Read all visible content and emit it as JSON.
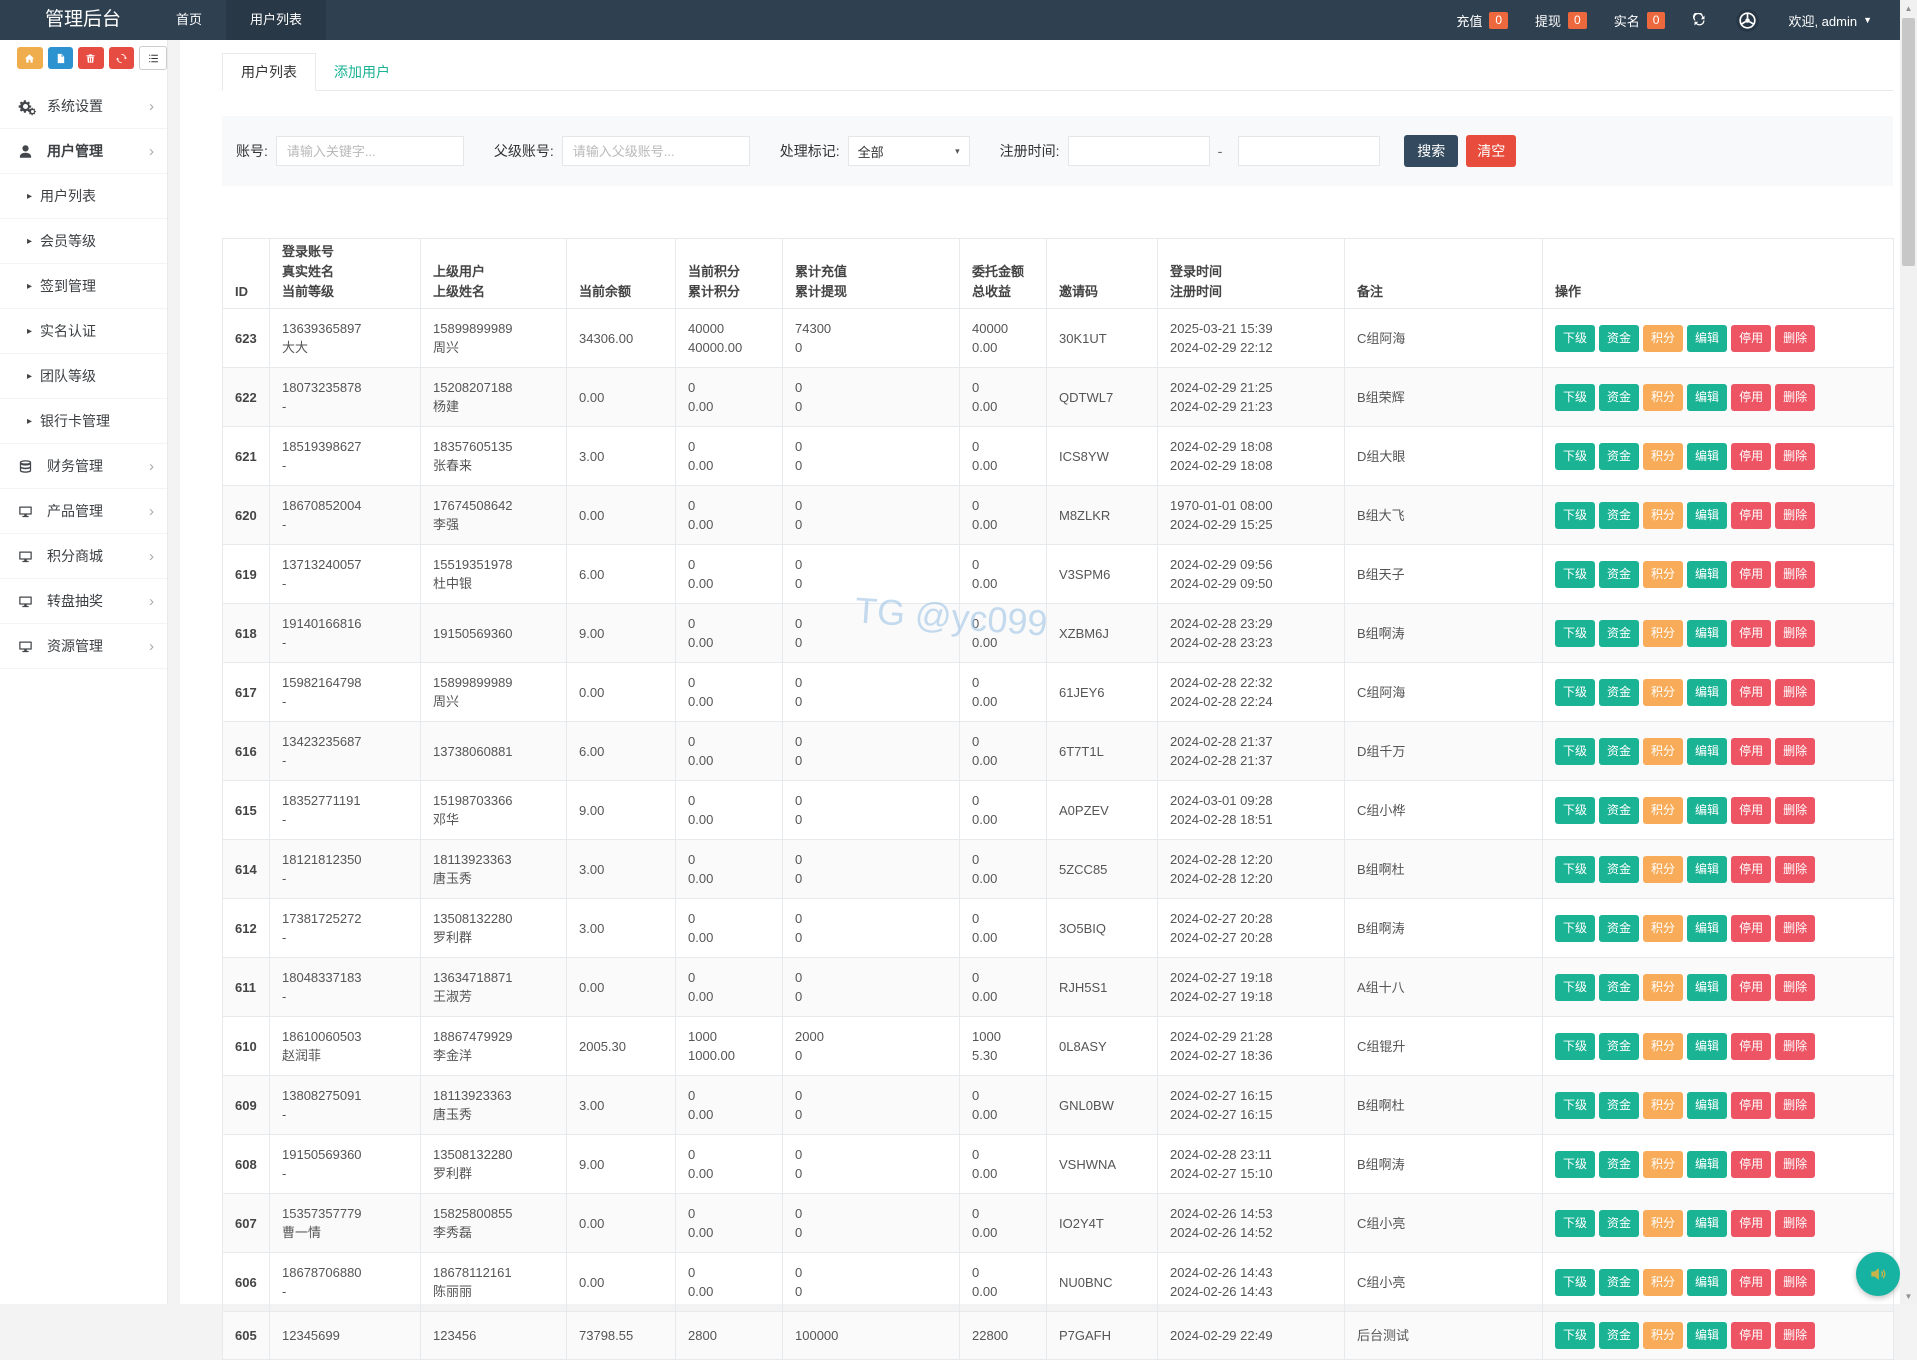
{
  "colors": {
    "navbar": "#2f4050",
    "navbar_active_tab": "#293846",
    "teal": "#1ab394",
    "orange": "#f8ac59",
    "red": "#ed5565",
    "badge": "#ed683c",
    "search_btn": "#344a5e",
    "clear_btn": "#e74c3c",
    "float_btn": "#16b2a2"
  },
  "icons": {
    "chevron": "›",
    "sub_arrow": "▸",
    "caret_down": "▼",
    "select_caret": "▾",
    "range_separator": "-",
    "scroll_up": "▲",
    "scroll_down": "▼"
  },
  "navbar": {
    "title": "管理后台",
    "tabs": [
      {
        "label": "首页",
        "cls": ""
      },
      {
        "label": "用户列表",
        "cls": "active"
      }
    ],
    "badges": [
      {
        "label": "充值",
        "count": "0"
      },
      {
        "label": "提现",
        "count": "0"
      },
      {
        "label": "实名",
        "count": "0"
      }
    ],
    "welcome": "欢迎, admin"
  },
  "sidebar": {
    "toolbar": [
      {
        "icon": "home",
        "cls": "home"
      },
      {
        "icon": "file",
        "cls": "file"
      },
      {
        "icon": "trash",
        "cls": "trash"
      },
      {
        "icon": "recycle",
        "cls": "recycle"
      },
      {
        "icon": "list",
        "cls": "list"
      }
    ],
    "menu": [
      {
        "type": "parent",
        "icon": "gears",
        "label": "系统设置"
      },
      {
        "type": "parent active",
        "icon": "user",
        "label": "用户管理"
      },
      {
        "type": "child",
        "label": "用户列表"
      },
      {
        "type": "child",
        "label": "会员等级"
      },
      {
        "type": "child",
        "label": "签到管理"
      },
      {
        "type": "child",
        "label": "实名认证"
      },
      {
        "type": "child",
        "label": "团队等级"
      },
      {
        "type": "child",
        "label": "银行卡管理"
      },
      {
        "type": "parent",
        "icon": "database",
        "label": "财务管理"
      },
      {
        "type": "parent",
        "icon": "monitor",
        "label": "产品管理"
      },
      {
        "type": "parent",
        "icon": "monitor",
        "label": "积分商城"
      },
      {
        "type": "parent",
        "icon": "monitor",
        "label": "转盘抽奖"
      },
      {
        "type": "parent",
        "icon": "monitor",
        "label": "资源管理"
      }
    ]
  },
  "content": {
    "tabs": [
      "用户列表",
      "添加用户"
    ],
    "filters": {
      "account_label": "账号:",
      "account_placeholder": "请输入关键字...",
      "parent_label": "父级账号:",
      "parent_placeholder": "请输入父级账号...",
      "flag_label": "处理标记:",
      "flag_value": "全部",
      "regtime_label": "注册时间:",
      "search": "搜索",
      "clear": "清空"
    },
    "watermark": "TG @yc099",
    "table": {
      "headers": [
        {
          "text": "ID"
        },
        {
          "text": "登录账号\n真实姓名\n当前等级"
        },
        {
          "text": "上级用户\n上级姓名"
        },
        {
          "text": "当前余额"
        },
        {
          "text": "当前积分\n累计积分"
        },
        {
          "text": "累计充值\n累计提现"
        },
        {
          "text": "委托金额\n总收益"
        },
        {
          "text": "邀请码"
        },
        {
          "text": "登录时间\n注册时间"
        },
        {
          "text": "备注"
        },
        {
          "text": "操作"
        }
      ],
      "actions": [
        {
          "label": "下级",
          "color": "teal"
        },
        {
          "label": "资金",
          "color": "teal"
        },
        {
          "label": "积分",
          "color": "orange"
        },
        {
          "label": "编辑",
          "color": "teal"
        },
        {
          "label": "停用",
          "color": "red"
        },
        {
          "label": "删除",
          "color": "red"
        }
      ],
      "rows": [
        {
          "id": "623",
          "account": "13639365897\n大大",
          "parent": "15899899989\n周兴",
          "balance": "34306.00",
          "points": "40000\n40000.00",
          "recharge": "74300\n0",
          "entrust": "40000\n0.00",
          "code": "30K1UT",
          "time": "2025-03-21 15:39\n2024-02-29 22:12",
          "remark": "C组阿海"
        },
        {
          "id": "622",
          "account": "18073235878\n-",
          "parent": "15208207188\n杨建",
          "balance": "0.00",
          "points": "0\n0.00",
          "recharge": "0\n0",
          "entrust": "0\n0.00",
          "code": "QDTWL7",
          "time": "2024-02-29 21:25\n2024-02-29 21:23",
          "remark": "B组荣辉"
        },
        {
          "id": "621",
          "account": "18519398627\n-",
          "parent": "18357605135\n张春来",
          "balance": "3.00",
          "points": "0\n0.00",
          "recharge": "0\n0",
          "entrust": "0\n0.00",
          "code": "ICS8YW",
          "time": "2024-02-29 18:08\n2024-02-29 18:08",
          "remark": "D组大眼"
        },
        {
          "id": "620",
          "account": "18670852004\n-",
          "parent": "17674508642\n李强",
          "balance": "0.00",
          "points": "0\n0.00",
          "recharge": "0\n0",
          "entrust": "0\n0.00",
          "code": "M8ZLKR",
          "time": "1970-01-01 08:00\n2024-02-29 15:25",
          "remark": "B组大飞"
        },
        {
          "id": "619",
          "account": "13713240057\n-",
          "parent": "15519351978\n杜中银",
          "balance": "6.00",
          "points": "0\n0.00",
          "recharge": "0\n0",
          "entrust": "0\n0.00",
          "code": "V3SPM6",
          "time": "2024-02-29 09:56\n2024-02-29 09:50",
          "remark": "B组天子"
        },
        {
          "id": "618",
          "account": "19140166816\n-",
          "parent": "19150569360",
          "balance": "9.00",
          "points": "0\n0.00",
          "recharge": "0\n0",
          "entrust": "0\n0.00",
          "code": "XZBM6J",
          "time": "2024-02-28 23:29\n2024-02-28 23:23",
          "remark": "B组啊涛"
        },
        {
          "id": "617",
          "account": "15982164798\n-",
          "parent": "15899899989\n周兴",
          "balance": "0.00",
          "points": "0\n0.00",
          "recharge": "0\n0",
          "entrust": "0\n0.00",
          "code": "61JEY6",
          "time": "2024-02-28 22:32\n2024-02-28 22:24",
          "remark": "C组阿海"
        },
        {
          "id": "616",
          "account": "13423235687\n-",
          "parent": "13738060881",
          "balance": "6.00",
          "points": "0\n0.00",
          "recharge": "0\n0",
          "entrust": "0\n0.00",
          "code": "6T7T1L",
          "time": "2024-02-28 21:37\n2024-02-28 21:37",
          "remark": "D组千万"
        },
        {
          "id": "615",
          "account": "18352771191\n-",
          "parent": "15198703366\n邓华",
          "balance": "9.00",
          "points": "0\n0.00",
          "recharge": "0\n0",
          "entrust": "0\n0.00",
          "code": "A0PZEV",
          "time": "2024-03-01 09:28\n2024-02-28 18:51",
          "remark": "C组小桦"
        },
        {
          "id": "614",
          "account": "18121812350\n-",
          "parent": "18113923363\n唐玉秀",
          "balance": "3.00",
          "points": "0\n0.00",
          "recharge": "0\n0",
          "entrust": "0\n0.00",
          "code": "5ZCC85",
          "time": "2024-02-28 12:20\n2024-02-28 12:20",
          "remark": "B组啊杜"
        },
        {
          "id": "612",
          "account": "17381725272\n-",
          "parent": "13508132280\n罗利群",
          "balance": "3.00",
          "points": "0\n0.00",
          "recharge": "0\n0",
          "entrust": "0\n0.00",
          "code": "3O5BIQ",
          "time": "2024-02-27 20:28\n2024-02-27 20:28",
          "remark": "B组啊涛"
        },
        {
          "id": "611",
          "account": "18048337183\n-",
          "parent": "13634718871\n王淑芳",
          "balance": "0.00",
          "points": "0\n0.00",
          "recharge": "0\n0",
          "entrust": "0\n0.00",
          "code": "RJH5S1",
          "time": "2024-02-27 19:18\n2024-02-27 19:18",
          "remark": "A组十八"
        },
        {
          "id": "610",
          "account": "18610060503\n赵润菲",
          "parent": "18867479929\n李金洋",
          "balance": "2005.30",
          "points": "1000\n1000.00",
          "recharge": "2000\n0",
          "entrust": "1000\n5.30",
          "code": "0L8ASY",
          "time": "2024-02-29 21:28\n2024-02-27 18:36",
          "remark": "C组锟升"
        },
        {
          "id": "609",
          "account": "13808275091\n-",
          "parent": "18113923363\n唐玉秀",
          "balance": "3.00",
          "points": "0\n0.00",
          "recharge": "0\n0",
          "entrust": "0\n0.00",
          "code": "GNL0BW",
          "time": "2024-02-27 16:15\n2024-02-27 16:15",
          "remark": "B组啊杜"
        },
        {
          "id": "608",
          "account": "19150569360\n-",
          "parent": "13508132280\n罗利群",
          "balance": "9.00",
          "points": "0\n0.00",
          "recharge": "0\n0",
          "entrust": "0\n0.00",
          "code": "VSHWNA",
          "time": "2024-02-28 23:11\n2024-02-27 15:10",
          "remark": "B组啊涛"
        },
        {
          "id": "607",
          "account": "15357357779\n曹一情",
          "parent": "15825800855\n李秀磊",
          "balance": "0.00",
          "points": "0\n0.00",
          "recharge": "0\n0",
          "entrust": "0\n0.00",
          "code": "IO2Y4T",
          "time": "2024-02-26 14:53\n2024-02-26 14:52",
          "remark": "C组小亮"
        },
        {
          "id": "606",
          "account": "18678706880\n-",
          "parent": "18678112161\n陈丽丽",
          "balance": "0.00",
          "points": "0\n0.00",
          "recharge": "0\n0",
          "entrust": "0\n0.00",
          "code": "NU0BNC",
          "time": "2024-02-26 14:43\n2024-02-26 14:43",
          "remark": "C组小亮"
        },
        {
          "id": "605",
          "account": "12345699",
          "parent": "123456",
          "balance": "73798.55",
          "points": "2800",
          "recharge": "100000",
          "entrust": "22800",
          "code": "P7GAFH",
          "time": "2024-02-29 22:49",
          "remark": "后台测试"
        }
      ]
    }
  }
}
